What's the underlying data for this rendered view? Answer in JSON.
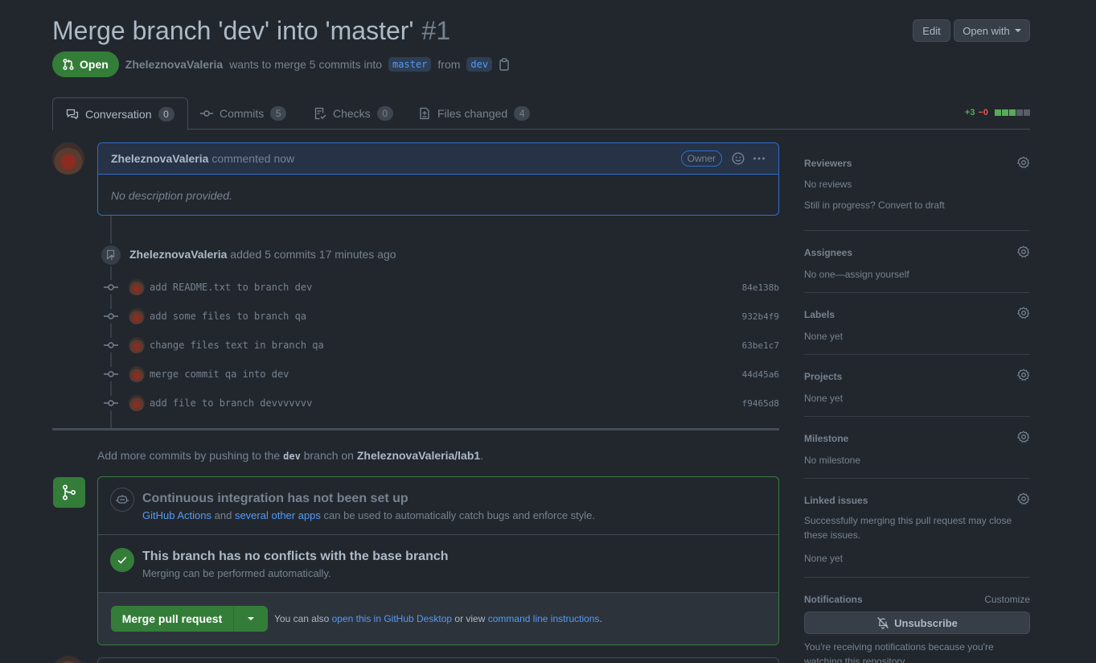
{
  "header": {
    "title": "Merge branch 'dev' into 'master'",
    "number": "#1",
    "edit_label": "Edit",
    "open_with_label": "Open with"
  },
  "meta": {
    "state": "Open",
    "author": "ZheleznovaValeria",
    "wants_to_merge": "wants to merge 5 commits into",
    "base_branch": "master",
    "from": "from",
    "head_branch": "dev"
  },
  "tabs": [
    {
      "label": "Conversation",
      "count": "0",
      "icon": "comment-discussion-icon"
    },
    {
      "label": "Commits",
      "count": "5",
      "icon": "git-commit-icon"
    },
    {
      "label": "Checks",
      "count": "0",
      "icon": "checklist-icon"
    },
    {
      "label": "Files changed",
      "count": "4",
      "icon": "file-diff-icon"
    }
  ],
  "diffstat": {
    "additions": "+3",
    "deletions": "−0",
    "add_blocks": 3,
    "neutral_blocks": 2
  },
  "comment": {
    "author": "ZheleznovaValeria",
    "action": "commented now",
    "badge": "Owner",
    "body": "No description provided."
  },
  "push_event": {
    "author": "ZheleznovaValeria",
    "text": "added 5 commits 17 minutes ago"
  },
  "commits": [
    {
      "message": "add README.txt to branch dev",
      "sha": "84e138b"
    },
    {
      "message": "add some files to branch qa",
      "sha": "932b4f9"
    },
    {
      "message": "change files text in branch qa",
      "sha": "63be1c7"
    },
    {
      "message": "merge commit qa into dev",
      "sha": "44d45a6"
    },
    {
      "message": "add file to branch devvvvvvv",
      "sha": "f9465d8"
    }
  ],
  "push_hint": {
    "prefix": "Add more commits by pushing to the",
    "branch": "dev",
    "middle": "branch on",
    "repo": "ZheleznovaValeria/lab1",
    "suffix": "."
  },
  "merge_box": {
    "ci_title": "Continuous integration has not been set up",
    "ci_link1": "GitHub Actions",
    "ci_and": "and",
    "ci_link2": "several other apps",
    "ci_rest": "can be used to automatically catch bugs and enforce style.",
    "conflicts_title": "This branch has no conflicts with the base branch",
    "conflicts_sub": "Merging can be performed automatically.",
    "merge_button": "Merge pull request",
    "alt_prefix": "You can also",
    "alt_link1": "open this in GitHub Desktop",
    "alt_or": "or view",
    "alt_link2": "command line instructions",
    "alt_suffix": "."
  },
  "sidebar": {
    "reviewers": {
      "title": "Reviewers",
      "value": "No reviews",
      "extra": "Still in progress? Convert to draft"
    },
    "assignees": {
      "title": "Assignees",
      "value": "No one—assign yourself"
    },
    "labels": {
      "title": "Labels",
      "value": "None yet"
    },
    "projects": {
      "title": "Projects",
      "value": "None yet"
    },
    "milestone": {
      "title": "Milestone",
      "value": "No milestone"
    },
    "linked_issues": {
      "title": "Linked issues",
      "desc": "Successfully merging this pull request may close these issues.",
      "value": "None yet"
    },
    "notifications": {
      "title": "Notifications",
      "customize": "Customize",
      "button": "Unsubscribe",
      "desc": "You're receiving notifications because you're watching this repository."
    }
  },
  "colors": {
    "accent": "#539bf5",
    "open_green": "#347d39",
    "add": "#57ab5a",
    "del": "#e5534b",
    "background": "#22272e"
  }
}
